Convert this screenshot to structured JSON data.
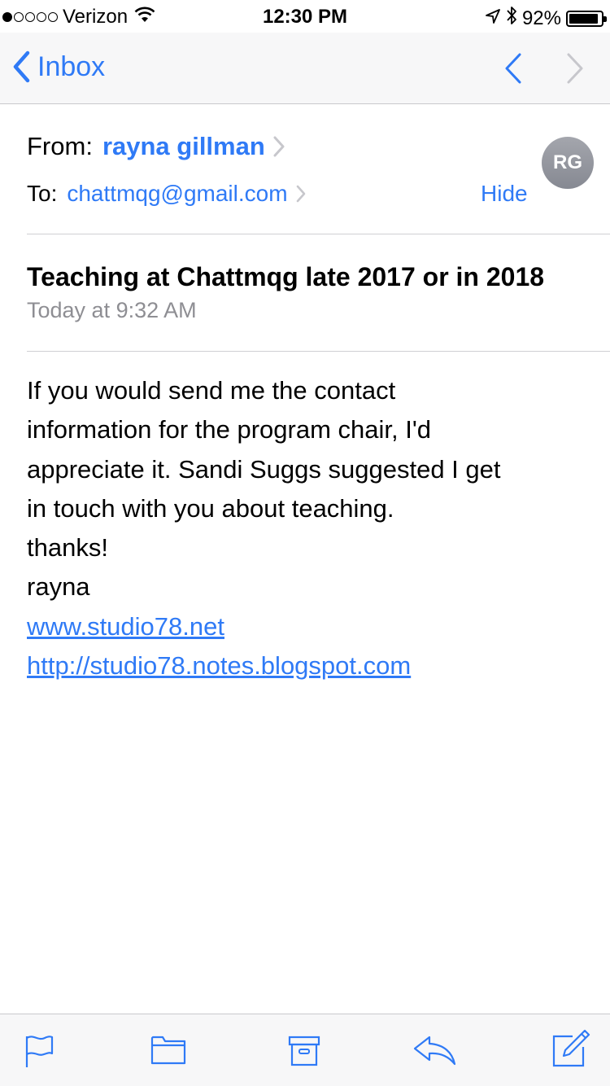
{
  "status_bar": {
    "carrier": "Verizon",
    "time": "12:30 PM",
    "battery": "92%",
    "battery_level": 0.92,
    "signal_bars": 1
  },
  "nav": {
    "back_label": "Inbox"
  },
  "header": {
    "from_label": "From:",
    "from_name": "rayna gillman",
    "to_label": "To:",
    "to_address": "chattmqg@gmail.com",
    "hide_label": "Hide",
    "avatar_initials": "RG"
  },
  "message": {
    "subject": "Teaching at Chattmqg late 2017 or in 2018",
    "date": "Today at 9:32 AM",
    "lines": [
      "If you would send me the contact",
      "information for the program chair, I'd",
      "appreciate it.  Sandi Suggs suggested I get",
      "in touch with you about teaching.",
      "thanks!",
      "rayna"
    ],
    "links": [
      "www.studio78.net",
      "http://studio78.notes.blogspot.com"
    ]
  },
  "colors": {
    "accent": "#2f7af6",
    "secondary_text": "#8e8e93",
    "bar_background": "#f7f7f8"
  },
  "toolbar_icons": [
    "flag-icon",
    "folder-icon",
    "archive-icon",
    "reply-icon",
    "compose-icon"
  ]
}
